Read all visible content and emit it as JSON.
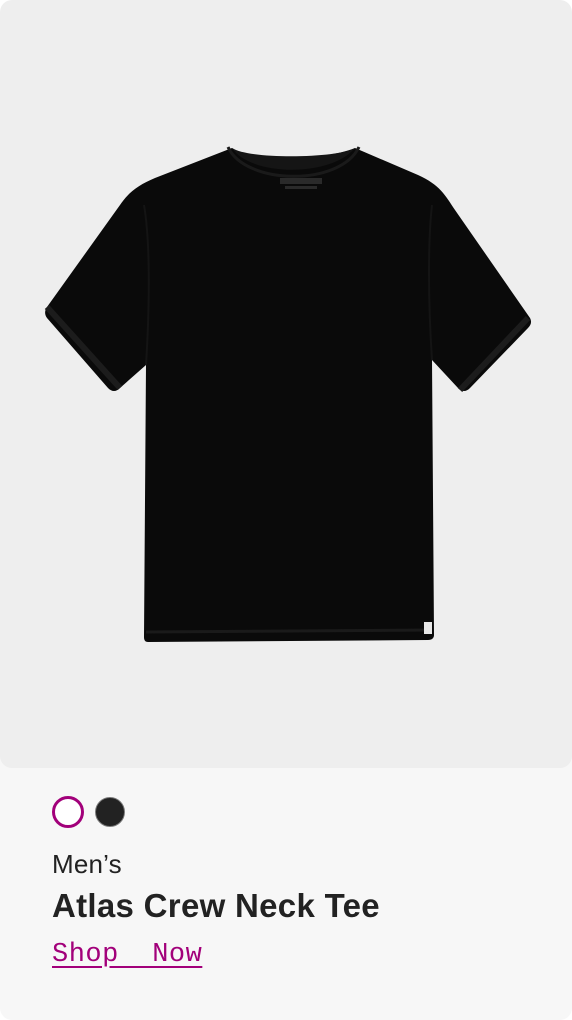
{
  "product": {
    "image_alt_icon": "tshirt-icon",
    "image_color": "#0a0a0a",
    "background_color": "#eeeeee",
    "swatches": [
      {
        "name": "light-option",
        "selected": true,
        "accent": "#a2007a"
      },
      {
        "name": "black-option",
        "selected": false,
        "color": "#222222"
      }
    ],
    "category": "Men’s",
    "title": "Atlas Crew Neck Tee",
    "cta_label": "Shop  Now",
    "accent_color": "#a2007a"
  }
}
